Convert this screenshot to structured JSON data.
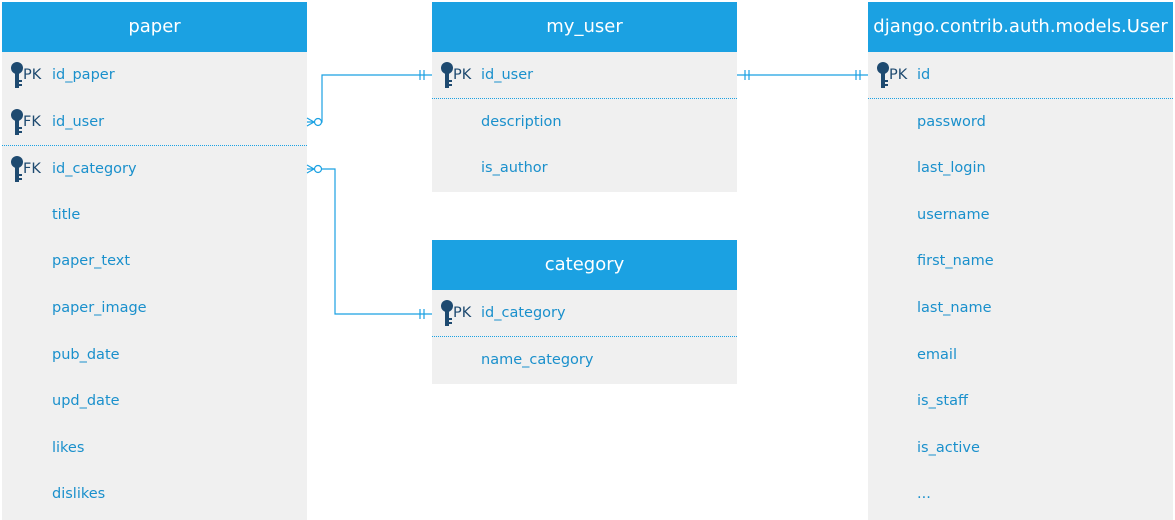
{
  "entities": {
    "paper": {
      "title": "paper",
      "rows": [
        {
          "key": "PK",
          "name": "id_paper"
        },
        {
          "key": "FK",
          "name": "id_user"
        },
        {
          "key": "FK",
          "name": "id_category"
        },
        {
          "key": "",
          "name": "title"
        },
        {
          "key": "",
          "name": "paper_text"
        },
        {
          "key": "",
          "name": "paper_image"
        },
        {
          "key": "",
          "name": "pub_date"
        },
        {
          "key": "",
          "name": "upd_date"
        },
        {
          "key": "",
          "name": "likes"
        },
        {
          "key": "",
          "name": "dislikes"
        }
      ]
    },
    "my_user": {
      "title": "my_user",
      "rows": [
        {
          "key": "PK",
          "name": "id_user"
        },
        {
          "key": "",
          "name": "description"
        },
        {
          "key": "",
          "name": "is_author"
        }
      ]
    },
    "category": {
      "title": "category",
      "rows": [
        {
          "key": "PK",
          "name": "id_category"
        },
        {
          "key": "",
          "name": "name_category"
        }
      ]
    },
    "auth_user": {
      "title": "django.contrib.auth.models.User",
      "rows": [
        {
          "key": "PK",
          "name": "id"
        },
        {
          "key": "",
          "name": "password"
        },
        {
          "key": "",
          "name": "last_login"
        },
        {
          "key": "",
          "name": "username"
        },
        {
          "key": "",
          "name": "first_name"
        },
        {
          "key": "",
          "name": "last_name"
        },
        {
          "key": "",
          "name": "email"
        },
        {
          "key": "",
          "name": "is_staff"
        },
        {
          "key": "",
          "name": "is_active"
        },
        {
          "key": "",
          "name": "..."
        }
      ]
    }
  },
  "colors": {
    "header": "#1ba1e2",
    "field_text": "#1a90cc",
    "key_icon": "#1e4a70",
    "connector": "#1ba1e2"
  }
}
